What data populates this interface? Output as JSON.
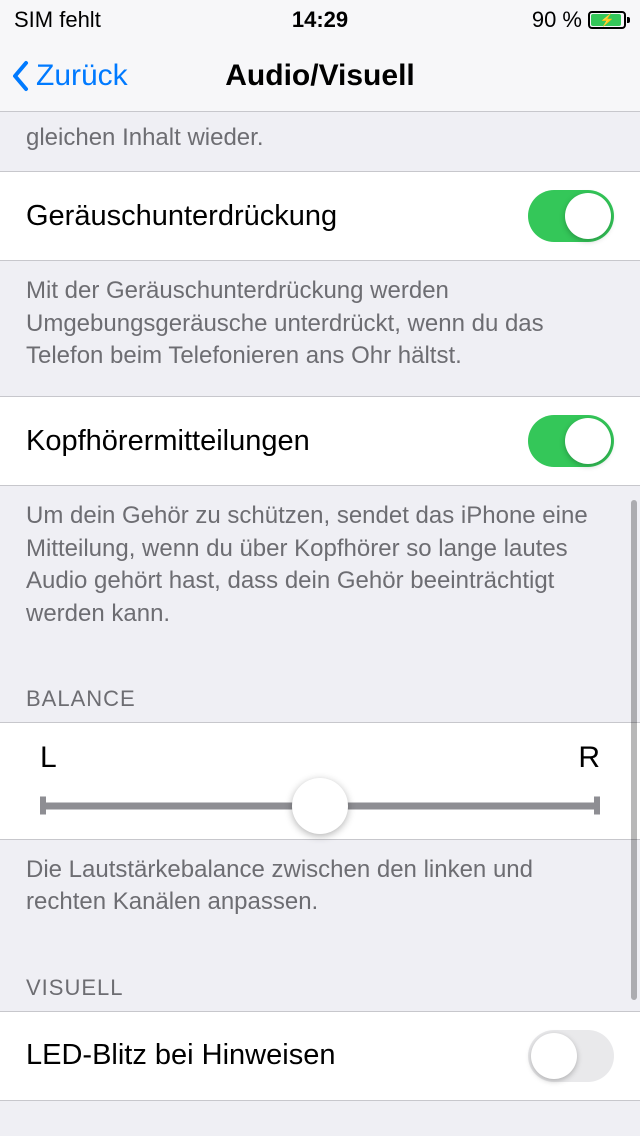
{
  "status": {
    "sim": "SIM fehlt",
    "time": "14:29",
    "battery_pct": "90 %"
  },
  "nav": {
    "back": "Zurück",
    "title": "Audio/Visuell"
  },
  "partial_top_footer": "gleichen Inhalt wieder.",
  "noise_cancel": {
    "label": "Geräuschunterdrückung",
    "footer": "Mit der Geräuschunterdrückung werden Umgebungsgeräusche unterdrückt, wenn du das Telefon beim Telefonieren ans Ohr hältst."
  },
  "headphone_notif": {
    "label": "Kopfhörermitteilungen",
    "footer": "Um dein Gehör zu schützen, sendet das iPhone eine Mitteilung, wenn du über Kopfhörer so lange lautes Audio gehört hast, dass dein Gehör beeinträchtigt werden kann."
  },
  "balance": {
    "header": "BALANCE",
    "left": "L",
    "right": "R",
    "footer": "Die Lautstärkebalance zwischen den linken und rechten Kanälen anpassen."
  },
  "visual": {
    "header": "VISUELL",
    "led_flash": "LED-Blitz bei Hinweisen"
  }
}
